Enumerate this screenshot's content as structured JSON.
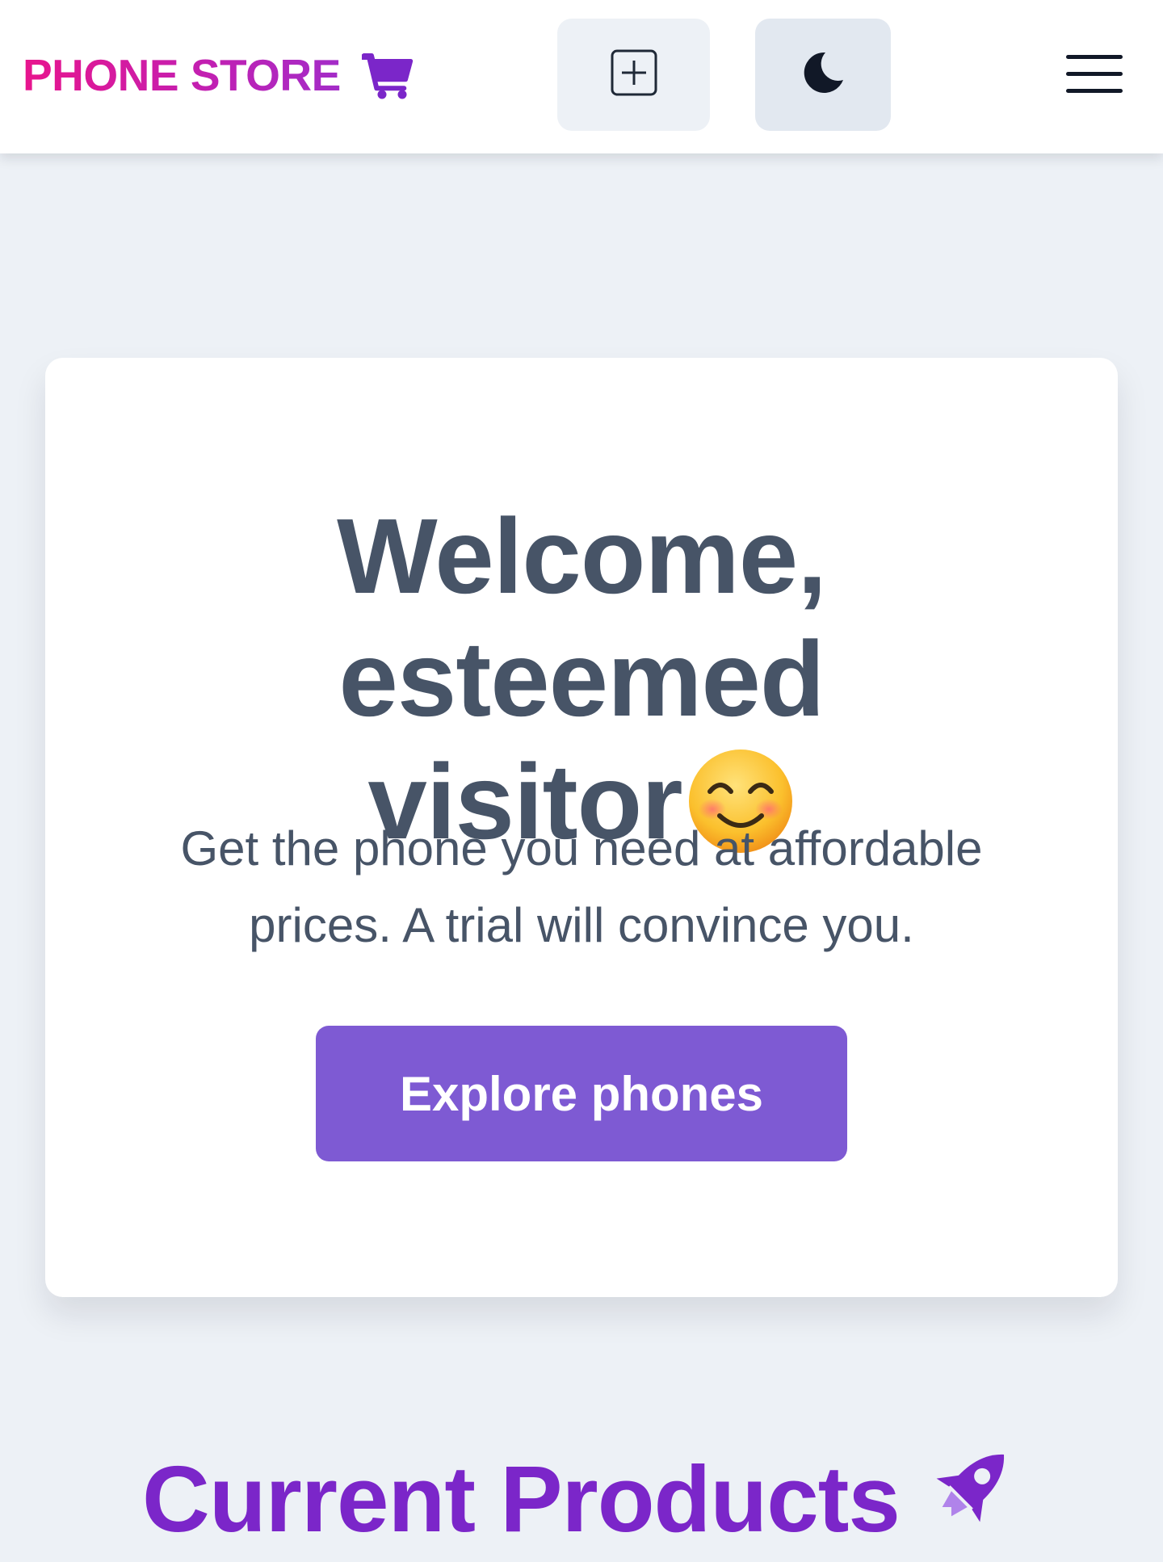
{
  "navbar": {
    "brand": "PHONE STORE",
    "icons": {
      "cart": "shopping-cart-icon",
      "add": "plus-square-icon",
      "theme": "moon-icon",
      "menu": "hamburger-menu-icon"
    }
  },
  "hero": {
    "title_line1": "Welcome, esteemed",
    "title_line2": "visitor",
    "title_emoji": "smiling-face-emoji",
    "subtitle": "Get the phone you need at affordable prices. A trial will convince you.",
    "button_label": "Explore phones"
  },
  "products": {
    "heading": "Current Products",
    "heading_icon": "rocket-icon"
  },
  "colors": {
    "page_background": "#edf1f6",
    "brand_gradient_start": "#e8158d",
    "brand_gradient_end": "#a32cc8",
    "accent_purple": "#7b26c9",
    "button_purple": "#7e5ad3",
    "text_slate": "#475467"
  }
}
